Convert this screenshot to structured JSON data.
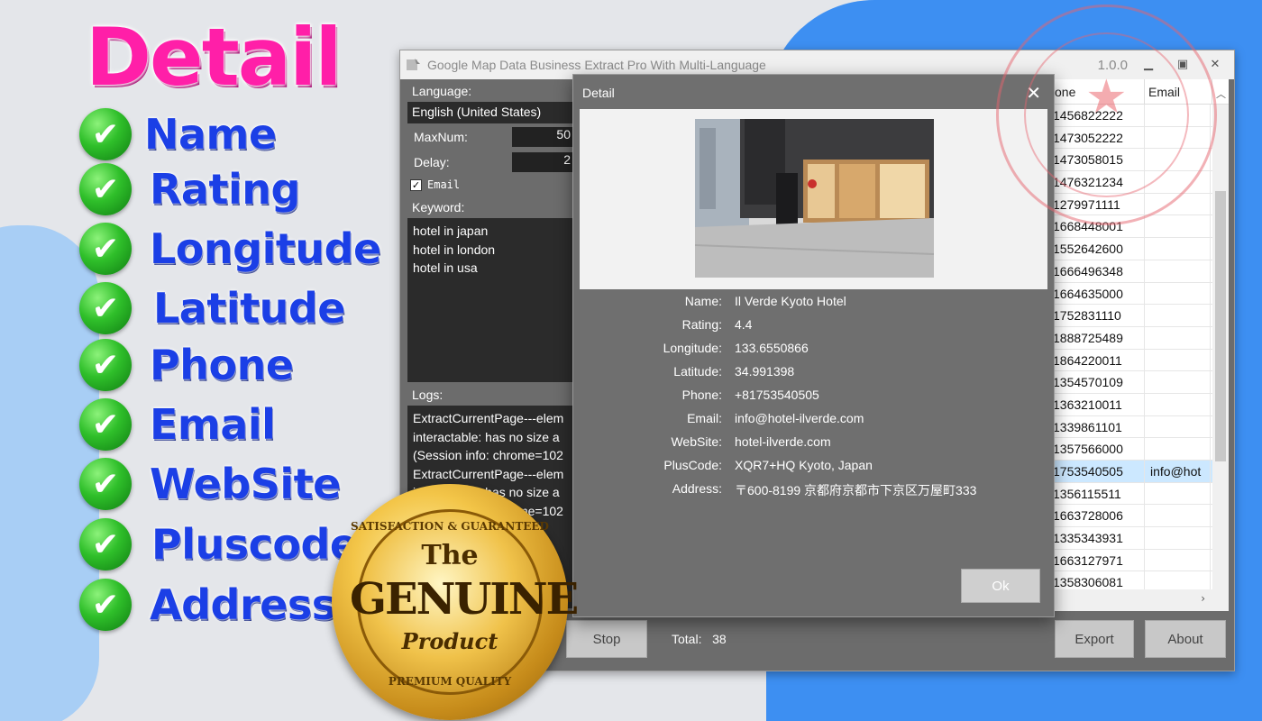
{
  "promo": {
    "title": "Detail",
    "features": [
      "Name",
      "Rating",
      "Longitude",
      "Latitude",
      "Phone",
      "Email",
      "WebSite",
      "Pluscode",
      "Address"
    ]
  },
  "seal": {
    "top_text": "SATISFACTION & GUARANTEED",
    "the": "The",
    "genuine": "GENUINE",
    "product": "Product",
    "bottom_text": "PREMIUM QUALITY"
  },
  "window": {
    "title": "Google Map Data Business Extract Pro With Multi-Language",
    "version": "1.0.0"
  },
  "settings": {
    "language_label": "Language:",
    "language_value": "English (United States)",
    "maxnum_label": "MaxNum:",
    "maxnum_value": "50",
    "delay_label": "Delay:",
    "delay_value": "2",
    "email_checkbox_label": "Email",
    "email_checked": true,
    "keyword_label": "Keyword:",
    "keywords": [
      "hotel in japan",
      "hotel in london",
      "hotel in usa"
    ],
    "logs_label": "Logs:",
    "logs": [
      "ExtractCurrentPage---elem",
      "interactable:  has no size a",
      "(Session info: chrome=102",
      "ExtractCurrentPage---elem",
      "interactable:  has no size a",
      "(Session info: chrome=102"
    ]
  },
  "table": {
    "columns": [
      "one",
      "Email"
    ],
    "rows": [
      {
        "phone": "1456822222",
        "email": ""
      },
      {
        "phone": "1473052222",
        "email": ""
      },
      {
        "phone": "1473058015",
        "email": ""
      },
      {
        "phone": "1476321234",
        "email": ""
      },
      {
        "phone": "1279971111",
        "email": ""
      },
      {
        "phone": "1668448001",
        "email": ""
      },
      {
        "phone": "1552642600",
        "email": ""
      },
      {
        "phone": "1666496348",
        "email": ""
      },
      {
        "phone": "1664635000",
        "email": ""
      },
      {
        "phone": "1752831110",
        "email": ""
      },
      {
        "phone": "1888725489",
        "email": ""
      },
      {
        "phone": "1864220011",
        "email": ""
      },
      {
        "phone": "1354570109",
        "email": ""
      },
      {
        "phone": "1363210011",
        "email": ""
      },
      {
        "phone": "1339861101",
        "email": ""
      },
      {
        "phone": "1357566000",
        "email": ""
      },
      {
        "phone": "1753540505",
        "email": "info@hot",
        "selected": true
      },
      {
        "phone": "1356115511",
        "email": ""
      },
      {
        "phone": "1663728006",
        "email": ""
      },
      {
        "phone": "1335343931",
        "email": ""
      },
      {
        "phone": "1663127971",
        "email": ""
      },
      {
        "phone": "1358306081",
        "email": ""
      }
    ]
  },
  "bottom": {
    "stop_label": "Stop",
    "total_label": "Total:",
    "total_value": "38",
    "export_label": "Export",
    "about_label": "About"
  },
  "detail": {
    "title": "Detail",
    "fields": [
      {
        "key": "Name:",
        "value": "Il Verde Kyoto Hotel"
      },
      {
        "key": "Rating:",
        "value": "4.4"
      },
      {
        "key": "Longitude:",
        "value": "133.6550866"
      },
      {
        "key": "Latitude:",
        "value": "34.991398"
      },
      {
        "key": "Phone:",
        "value": "+81753540505"
      },
      {
        "key": "Email:",
        "value": "info@hotel-ilverde.com"
      },
      {
        "key": "WebSite:",
        "value": " hotel-ilverde.com"
      },
      {
        "key": "PlusCode:",
        "value": " XQR7+HQ Kyoto, Japan"
      },
      {
        "key": "Address:",
        "value": " 〒600-8199 京都府京都市下京区万屋町333"
      }
    ],
    "ok_label": "Ok"
  },
  "colors": {
    "title_pink": "#ff1fa8",
    "feature_blue": "#1b3fe6",
    "bg_blue": "#3d8ff2",
    "dialog_gray": "#6f6f6f"
  }
}
